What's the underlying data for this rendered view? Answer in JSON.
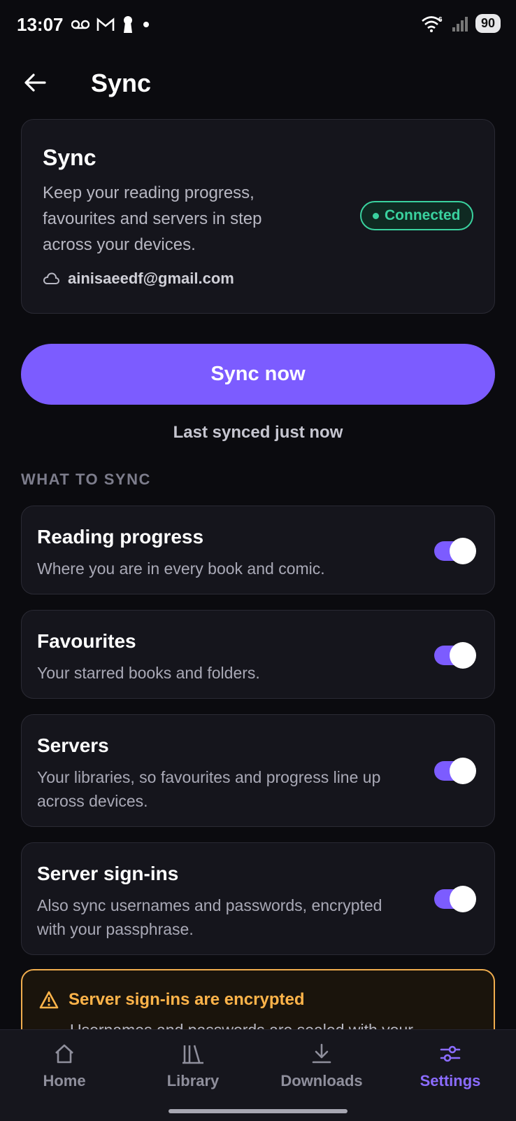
{
  "status": {
    "time": "13:07",
    "battery": "90",
    "network_tag": "6"
  },
  "header": {
    "title": "Sync"
  },
  "sync_card": {
    "title": "Sync",
    "description": "Keep your reading progress, favourites and servers in step across your devices.",
    "status_label": "Connected",
    "account_email": "ainisaeedf@gmail.com"
  },
  "sync_now": {
    "label": "Sync now"
  },
  "last_synced": "Last synced just now",
  "section": {
    "what_to_sync": "WHAT TO SYNC"
  },
  "toggles": [
    {
      "title": "Reading progress",
      "description": "Where you are in every book and comic.",
      "enabled": true
    },
    {
      "title": "Favourites",
      "description": "Your starred books and folders.",
      "enabled": true
    },
    {
      "title": "Servers",
      "description": "Your libraries, so favourites and progress line up across devices.",
      "enabled": true
    },
    {
      "title": "Server sign-ins",
      "description": "Also sync usernames and passwords, encrypted with your passphrase.",
      "enabled": true
    }
  ],
  "warning": {
    "title": "Server sign-ins are encrypted",
    "description": "Usernames and passwords are sealed with your"
  },
  "nav": {
    "items": [
      {
        "label": "Home",
        "icon": "home-icon",
        "active": false
      },
      {
        "label": "Library",
        "icon": "library-icon",
        "active": false
      },
      {
        "label": "Downloads",
        "icon": "download-icon",
        "active": false
      },
      {
        "label": "Settings",
        "icon": "settings-sliders-icon",
        "active": true
      }
    ]
  },
  "colors": {
    "accent": "#7c5cff",
    "connected": "#3ad29f",
    "warning": "#f0ad4e",
    "background": "#0b0b0f",
    "card": "#15151c"
  }
}
